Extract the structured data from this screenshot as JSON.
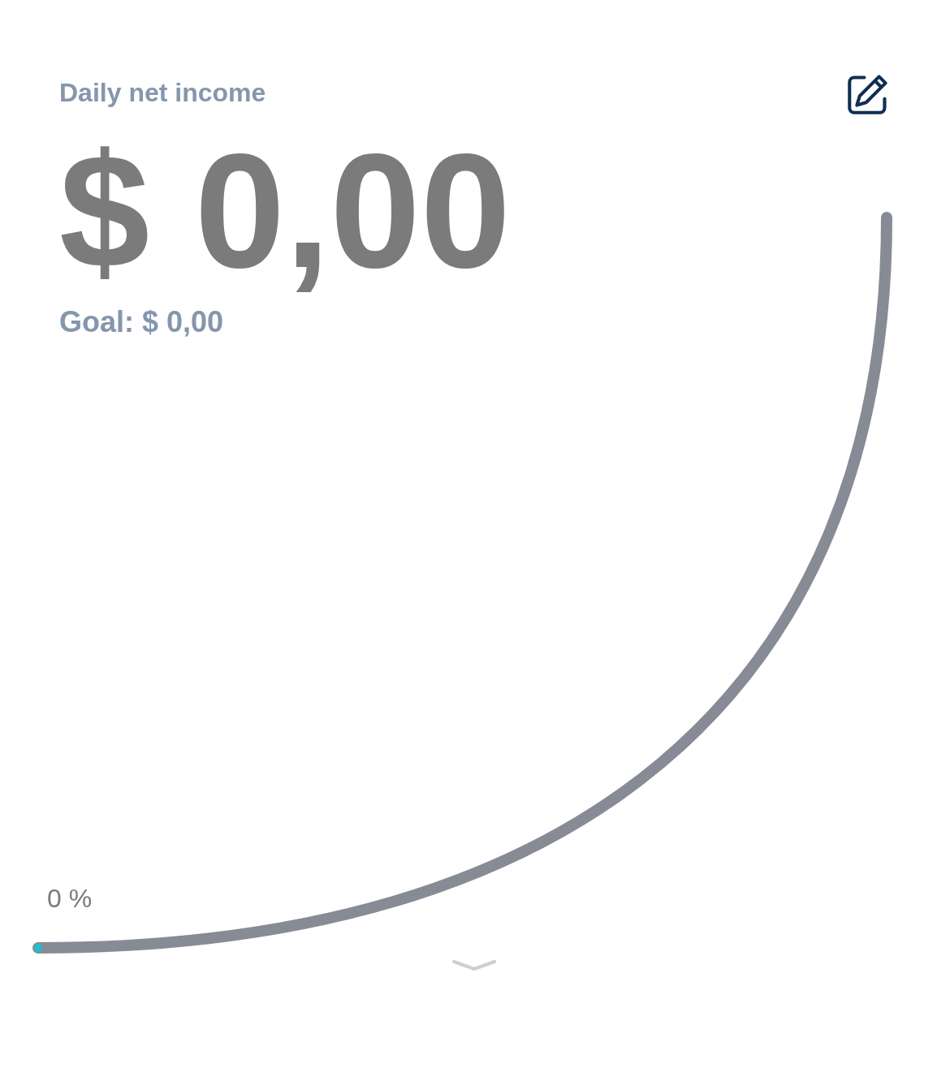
{
  "title": "Daily net income",
  "amount": "$ 0,00",
  "goal": "Goal: $ 0,00",
  "progress": {
    "level": 0,
    "label": "0 %"
  }
}
